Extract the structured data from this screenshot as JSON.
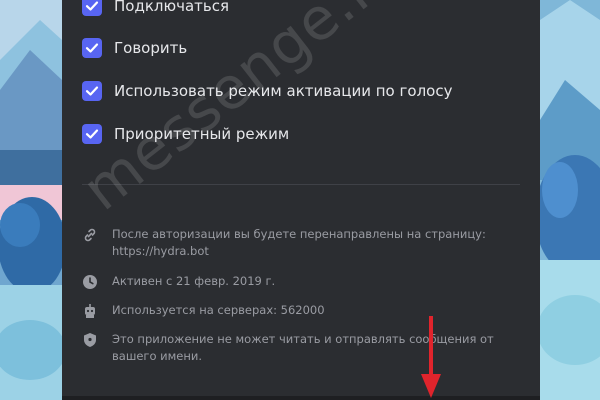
{
  "permissions": [
    {
      "label": "Подключаться",
      "checked": true
    },
    {
      "label": "Говорить",
      "checked": true
    },
    {
      "label": "Использовать режим активации по голосу",
      "checked": true
    },
    {
      "label": "Приоритетный режим",
      "checked": true
    }
  ],
  "info": {
    "redirect_line1": "После авторизации вы будете перенаправлены на страницу:",
    "redirect_line2": "https://hydra.bot",
    "active_since": "Активен с 21 февр. 2019 г.",
    "servers": "Используется на серверах: 562000",
    "privacy_line1": "Это приложение не может читать и отправлять сообщения от",
    "privacy_line2": "вашего имени."
  },
  "watermark": "messenge.ru",
  "icons": {
    "checkbox": "check-icon",
    "redirect": "link-icon",
    "active": "clock-icon",
    "servers": "robot-icon",
    "privacy": "shield-icon"
  },
  "colors": {
    "panel_bg": "#2b2d31",
    "checkbox": "#5865f2",
    "text_primary": "#e6e7ea",
    "text_secondary": "#9a9ca3",
    "arrow": "#e0242c"
  }
}
